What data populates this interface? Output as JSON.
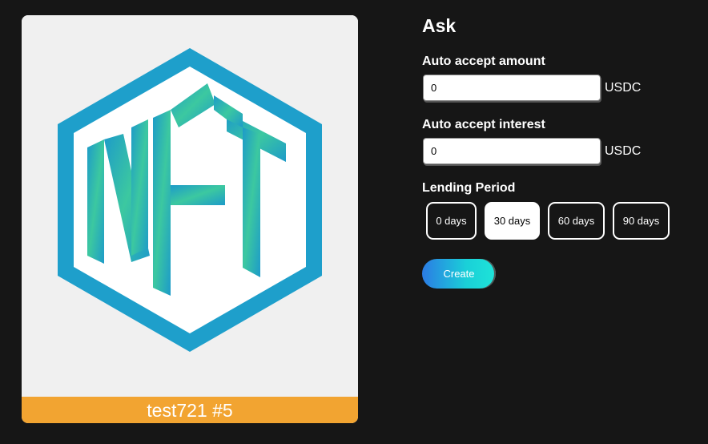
{
  "nft": {
    "caption": "test721 #5",
    "image_logo_text": "NFT",
    "caption_color": "#f2a431",
    "logo_colors": [
      "#1d9bc9",
      "#3cc8a0"
    ]
  },
  "ask": {
    "title": "Ask",
    "auto_accept_amount": {
      "label": "Auto accept amount",
      "value": "0",
      "unit": "USDC"
    },
    "auto_accept_interest": {
      "label": "Auto accept interest",
      "value": "0",
      "unit": "USDC"
    },
    "lending_period": {
      "label": "Lending Period",
      "options": [
        "0 days",
        "30 days",
        "60 days",
        "90 days"
      ],
      "selected": "30 days"
    },
    "create_label": "Create",
    "create_gradient": [
      "#2b7be4",
      "#1ee4d8"
    ]
  }
}
